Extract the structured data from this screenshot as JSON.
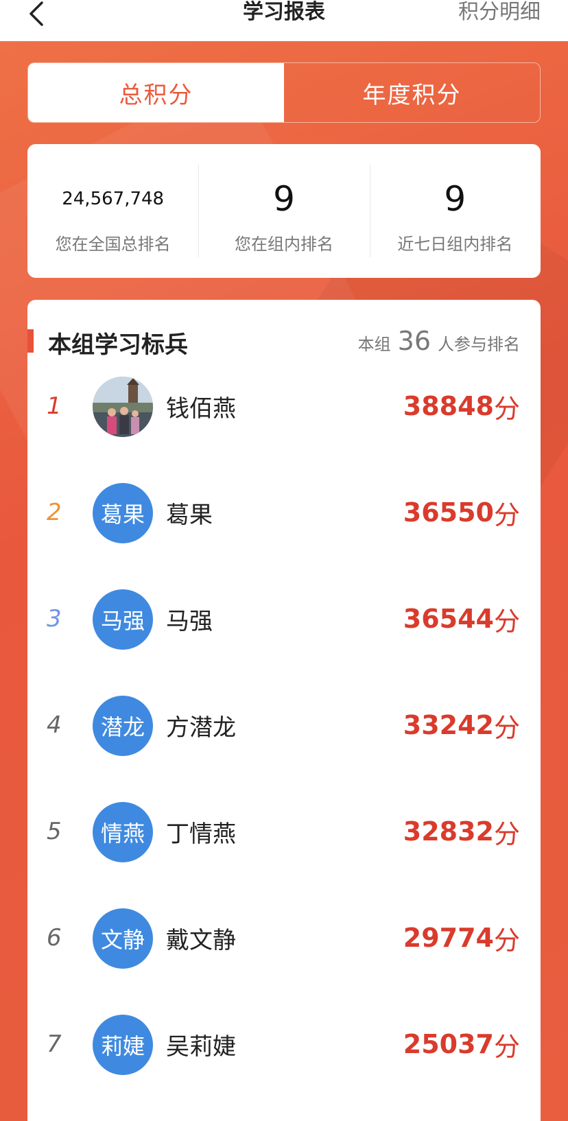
{
  "nav": {
    "back_icon": "chevron-left-icon",
    "title": "学习报表",
    "detail_label": "积分明细"
  },
  "tabs": [
    {
      "label": "总积分",
      "active": true
    },
    {
      "label": "年度积分",
      "active": false
    }
  ],
  "stats": [
    {
      "value": "24,567,748",
      "label": "您在全国总排名"
    },
    {
      "value": "9",
      "label": "您在组内排名"
    },
    {
      "value": "9",
      "label": "近七日组内排名"
    }
  ],
  "board": {
    "title": "本组学习标兵",
    "meta_prefix": "本组",
    "participant_count": "36",
    "meta_suffix": "人参与排名",
    "score_unit": "分",
    "rows": [
      {
        "rank": "1",
        "avatar_text": "",
        "avatar_type": "photo",
        "name": "钱佰燕",
        "score": "38848"
      },
      {
        "rank": "2",
        "avatar_text": "葛果",
        "avatar_type": "text",
        "name": "葛果",
        "score": "36550"
      },
      {
        "rank": "3",
        "avatar_text": "马强",
        "avatar_type": "text",
        "name": "马强",
        "score": "36544"
      },
      {
        "rank": "4",
        "avatar_text": "潜龙",
        "avatar_type": "text",
        "name": "方潜龙",
        "score": "33242"
      },
      {
        "rank": "5",
        "avatar_text": "情燕",
        "avatar_type": "text",
        "name": "丁情燕",
        "score": "32832"
      },
      {
        "rank": "6",
        "avatar_text": "文静",
        "avatar_type": "text",
        "name": "戴文静",
        "score": "29774"
      },
      {
        "rank": "7",
        "avatar_text": "莉婕",
        "avatar_type": "text",
        "name": "吴莉婕",
        "score": "25037"
      }
    ]
  },
  "colors": {
    "accent": "#ea5a3c",
    "score": "#d93b2c",
    "avatar": "#3f8ae0",
    "rank_1": "#d93b2c",
    "rank_2": "#f0913a",
    "rank_3": "#6e94e6",
    "rank_other": "#666666"
  }
}
